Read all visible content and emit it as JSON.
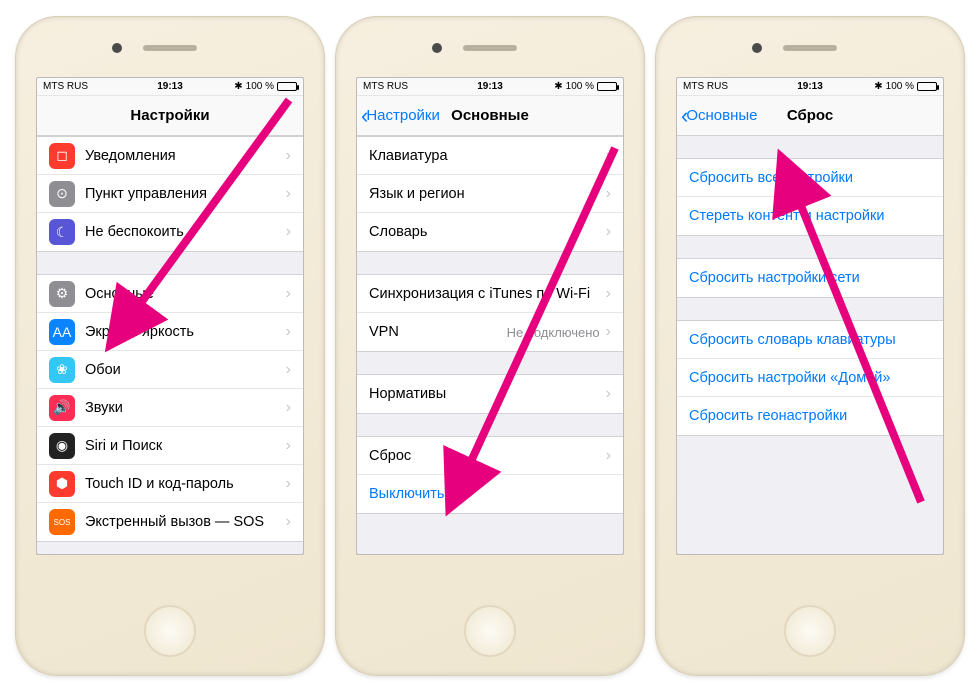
{
  "status": {
    "carrier": "MTS RUS",
    "time": "19:13",
    "bt": "⁎",
    "batt_text": "100 %",
    "batt_pct": 100
  },
  "phone1": {
    "title": "Настройки",
    "rows1": [
      {
        "label": "Уведомления",
        "icon_bg": "#ff3b30",
        "glyph": "◻"
      },
      {
        "label": "Пункт управления",
        "icon_bg": "#8e8e93",
        "glyph": "⊙"
      },
      {
        "label": "Не беспокоить",
        "icon_bg": "#5856d6",
        "glyph": "☾"
      }
    ],
    "rows2": [
      {
        "label": "Основные",
        "icon_bg": "#8e8e93",
        "glyph": "⚙"
      },
      {
        "label": "Экран и яркость",
        "icon_bg": "#0a84ff",
        "glyph": "AA"
      },
      {
        "label": "Обои",
        "icon_bg": "#34c6f4",
        "glyph": "❀"
      },
      {
        "label": "Звуки",
        "icon_bg": "#ff2d55",
        "glyph": "🔊"
      },
      {
        "label": "Siri и Поиск",
        "icon_bg": "#222",
        "glyph": "◉"
      },
      {
        "label": "Touch ID и код-пароль",
        "icon_bg": "#ff3b30",
        "glyph": "⬢"
      },
      {
        "label": "Экстренный вызов — SOS",
        "icon_bg": "#ff6a00",
        "glyph": "SOS"
      }
    ]
  },
  "phone2": {
    "back": "Настройки",
    "title": "Основные",
    "rows1": [
      {
        "label": "Клавиатура"
      },
      {
        "label": "Язык и регион"
      },
      {
        "label": "Словарь"
      }
    ],
    "rows2": [
      {
        "label": "Синхронизация с iTunes по Wi-Fi"
      },
      {
        "label": "VPN",
        "value": "Не подключено"
      }
    ],
    "rows3": [
      {
        "label": "Нормативы"
      }
    ],
    "rows4": [
      {
        "label": "Сброс"
      },
      {
        "label": "Выключить",
        "link": true
      }
    ]
  },
  "phone3": {
    "back": "Основные",
    "title": "Сброс",
    "group1": [
      {
        "label": "Сбросить все настройки"
      },
      {
        "label": "Стереть контент и настройки"
      }
    ],
    "group2": [
      {
        "label": "Сбросить настройки сети"
      }
    ],
    "group3": [
      {
        "label": "Сбросить словарь клавиатуры"
      },
      {
        "label": "Сбросить настройки «Домой»"
      },
      {
        "label": "Сбросить геонастройки"
      }
    ]
  }
}
